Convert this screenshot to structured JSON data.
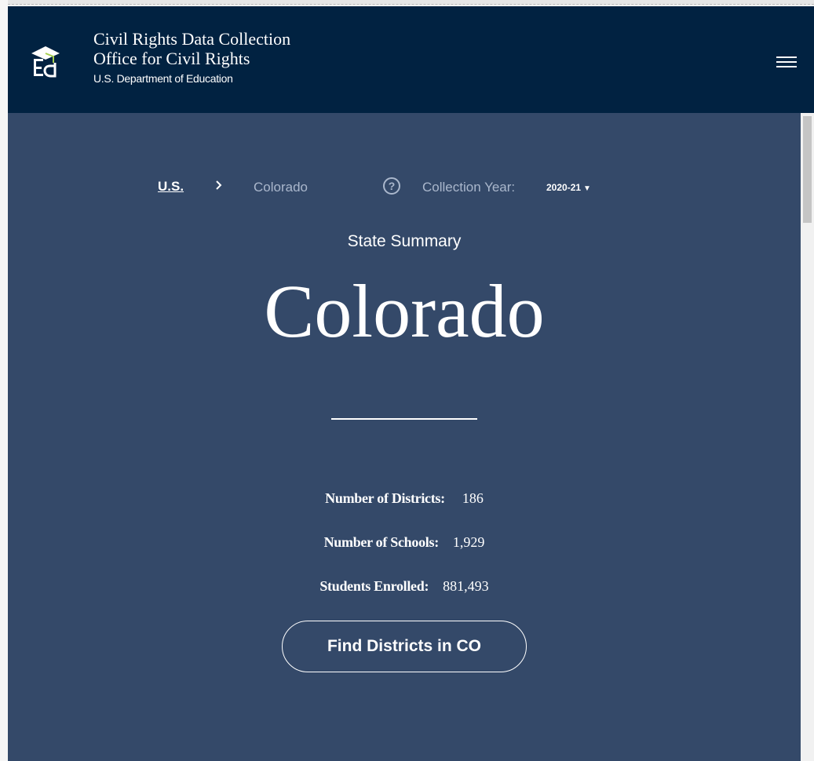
{
  "header": {
    "title_line1": "Civil Rights Data Collection",
    "title_line2": "Office for Civil Rights",
    "department": "U.S. Department of Education",
    "logo_icon": "ed-logo-icon",
    "menu_icon": "hamburger-menu-icon"
  },
  "breadcrumb": {
    "root": "U.S.",
    "separator_icon": "chevron-right-icon",
    "current": "Colorado"
  },
  "collection_year": {
    "help_icon": "question-circle-icon",
    "help_glyph": "?",
    "label": "Collection Year:",
    "selected": "2020-21",
    "caret": "▼"
  },
  "summary": {
    "label": "State Summary",
    "state": "Colorado"
  },
  "stats": {
    "districts_label": "Number of Districts:",
    "districts_value": "186",
    "schools_label": "Number of Schools:",
    "schools_value": "1,929",
    "students_label": "Students Enrolled:",
    "students_value": "881,493"
  },
  "actions": {
    "find_districts": "Find Districts in CO"
  },
  "colors": {
    "header_bg": "#012241",
    "main_bg": "#344969",
    "muted_text": "#aab7cc"
  }
}
